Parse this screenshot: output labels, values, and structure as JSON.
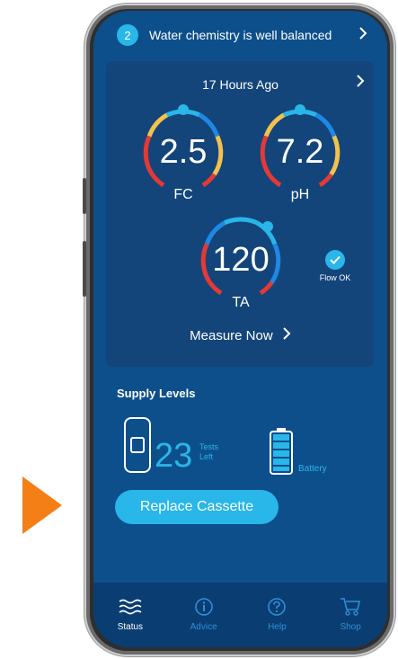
{
  "banner": {
    "count": "2",
    "message": "Water chemistry is well balanced"
  },
  "reading": {
    "time": "17 Hours Ago",
    "fc": {
      "value": "2.5",
      "label": "FC"
    },
    "ph": {
      "value": "7.2",
      "label": "pH"
    },
    "ta": {
      "value": "120",
      "label": "TA"
    },
    "flow_status": "Flow OK",
    "measure_label": "Measure Now"
  },
  "supply": {
    "title": "Supply Levels",
    "tests_left": "23",
    "tests_label_1": "Tests",
    "tests_label_2": "Left",
    "battery_label": "Battery"
  },
  "actions": {
    "replace_label": "Replace Cassette"
  },
  "nav": {
    "items": [
      {
        "label": "Status",
        "icon": "waves-icon",
        "active": true
      },
      {
        "label": "Advice",
        "icon": "info-icon",
        "active": false
      },
      {
        "label": "Help",
        "icon": "help-icon",
        "active": false
      },
      {
        "label": "Shop",
        "icon": "cart-icon",
        "active": false
      }
    ]
  },
  "colors": {
    "accent": "#29b6e8",
    "background": "#0d4f8b",
    "arrow": "#f57f17",
    "gauge_blue": "#1e88e5",
    "gauge_yellow": "#f2c14e",
    "gauge_red": "#e53935"
  }
}
